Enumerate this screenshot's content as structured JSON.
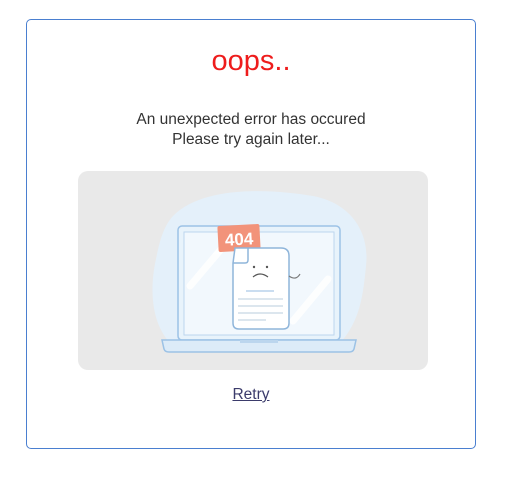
{
  "error": {
    "title": "oops..",
    "message_line1": "An unexpected error has occured",
    "message_line2": "Please try again later...",
    "illustration_code": "404",
    "retry_label": "Retry"
  },
  "colors": {
    "title": "#ee1c1c",
    "card_border": "#4a7fd0",
    "illustration_bg": "#e9e9e9",
    "badge": "#f2937a"
  }
}
